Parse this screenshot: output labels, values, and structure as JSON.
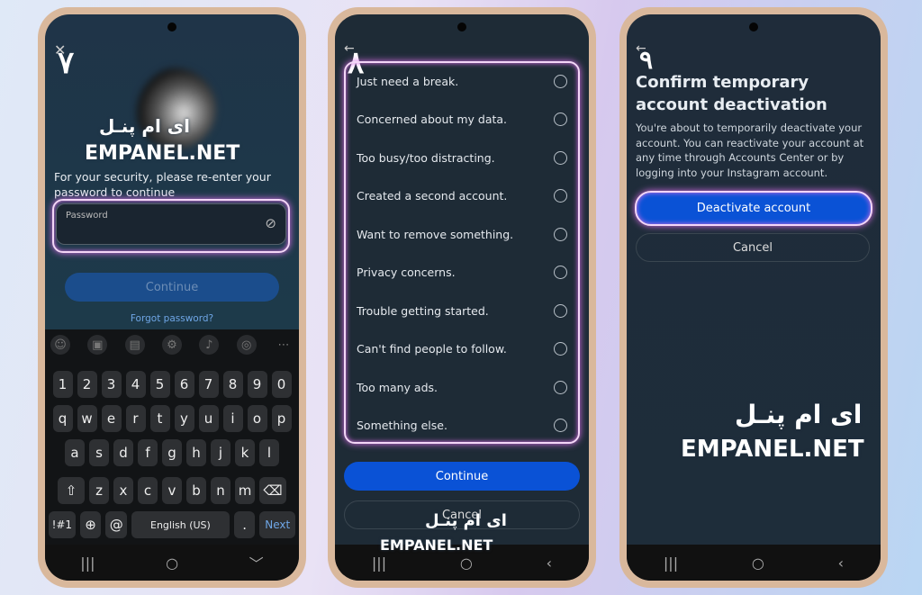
{
  "watermark": {
    "persian": "ای ام پنـل",
    "latin": "EMPANEL.NET"
  },
  "phone1": {
    "step": "۷",
    "prompt": "For your security, please re-enter your password to continue",
    "password_label": "Password",
    "continue": "Continue",
    "forgot": "Forgot password?",
    "keyboard": {
      "numbers": [
        "1",
        "2",
        "3",
        "4",
        "5",
        "6",
        "7",
        "8",
        "9",
        "0"
      ],
      "row1": [
        "q",
        "w",
        "e",
        "r",
        "t",
        "y",
        "u",
        "i",
        "o",
        "p"
      ],
      "row2": [
        "a",
        "s",
        "d",
        "f",
        "g",
        "h",
        "j",
        "k",
        "l"
      ],
      "row3": [
        "z",
        "x",
        "c",
        "v",
        "b",
        "n",
        "m"
      ],
      "sym": "!#1",
      "lang": "English (US)",
      "period": ".",
      "next": "Next"
    }
  },
  "phone2": {
    "step": "۸",
    "reasons": [
      "Just need a break.",
      "Concerned about my data.",
      "Too busy/too distracting.",
      "Created a second account.",
      "Want to remove something.",
      "Privacy concerns.",
      "Trouble getting started.",
      "Can't find people to follow.",
      "Too many ads.",
      "Something else."
    ],
    "continue": "Continue",
    "cancel": "Cancel"
  },
  "phone3": {
    "step": "۹",
    "title": "Confirm temporary account deactivation",
    "body": "You're about to temporarily deactivate your account. You can reactivate your account at any time through Accounts Center or by logging into your Instagram account.",
    "deactivate": "Deactivate account",
    "cancel": "Cancel"
  },
  "colors": {
    "accent": "#0a52d6",
    "glow": "#d86ee8"
  }
}
